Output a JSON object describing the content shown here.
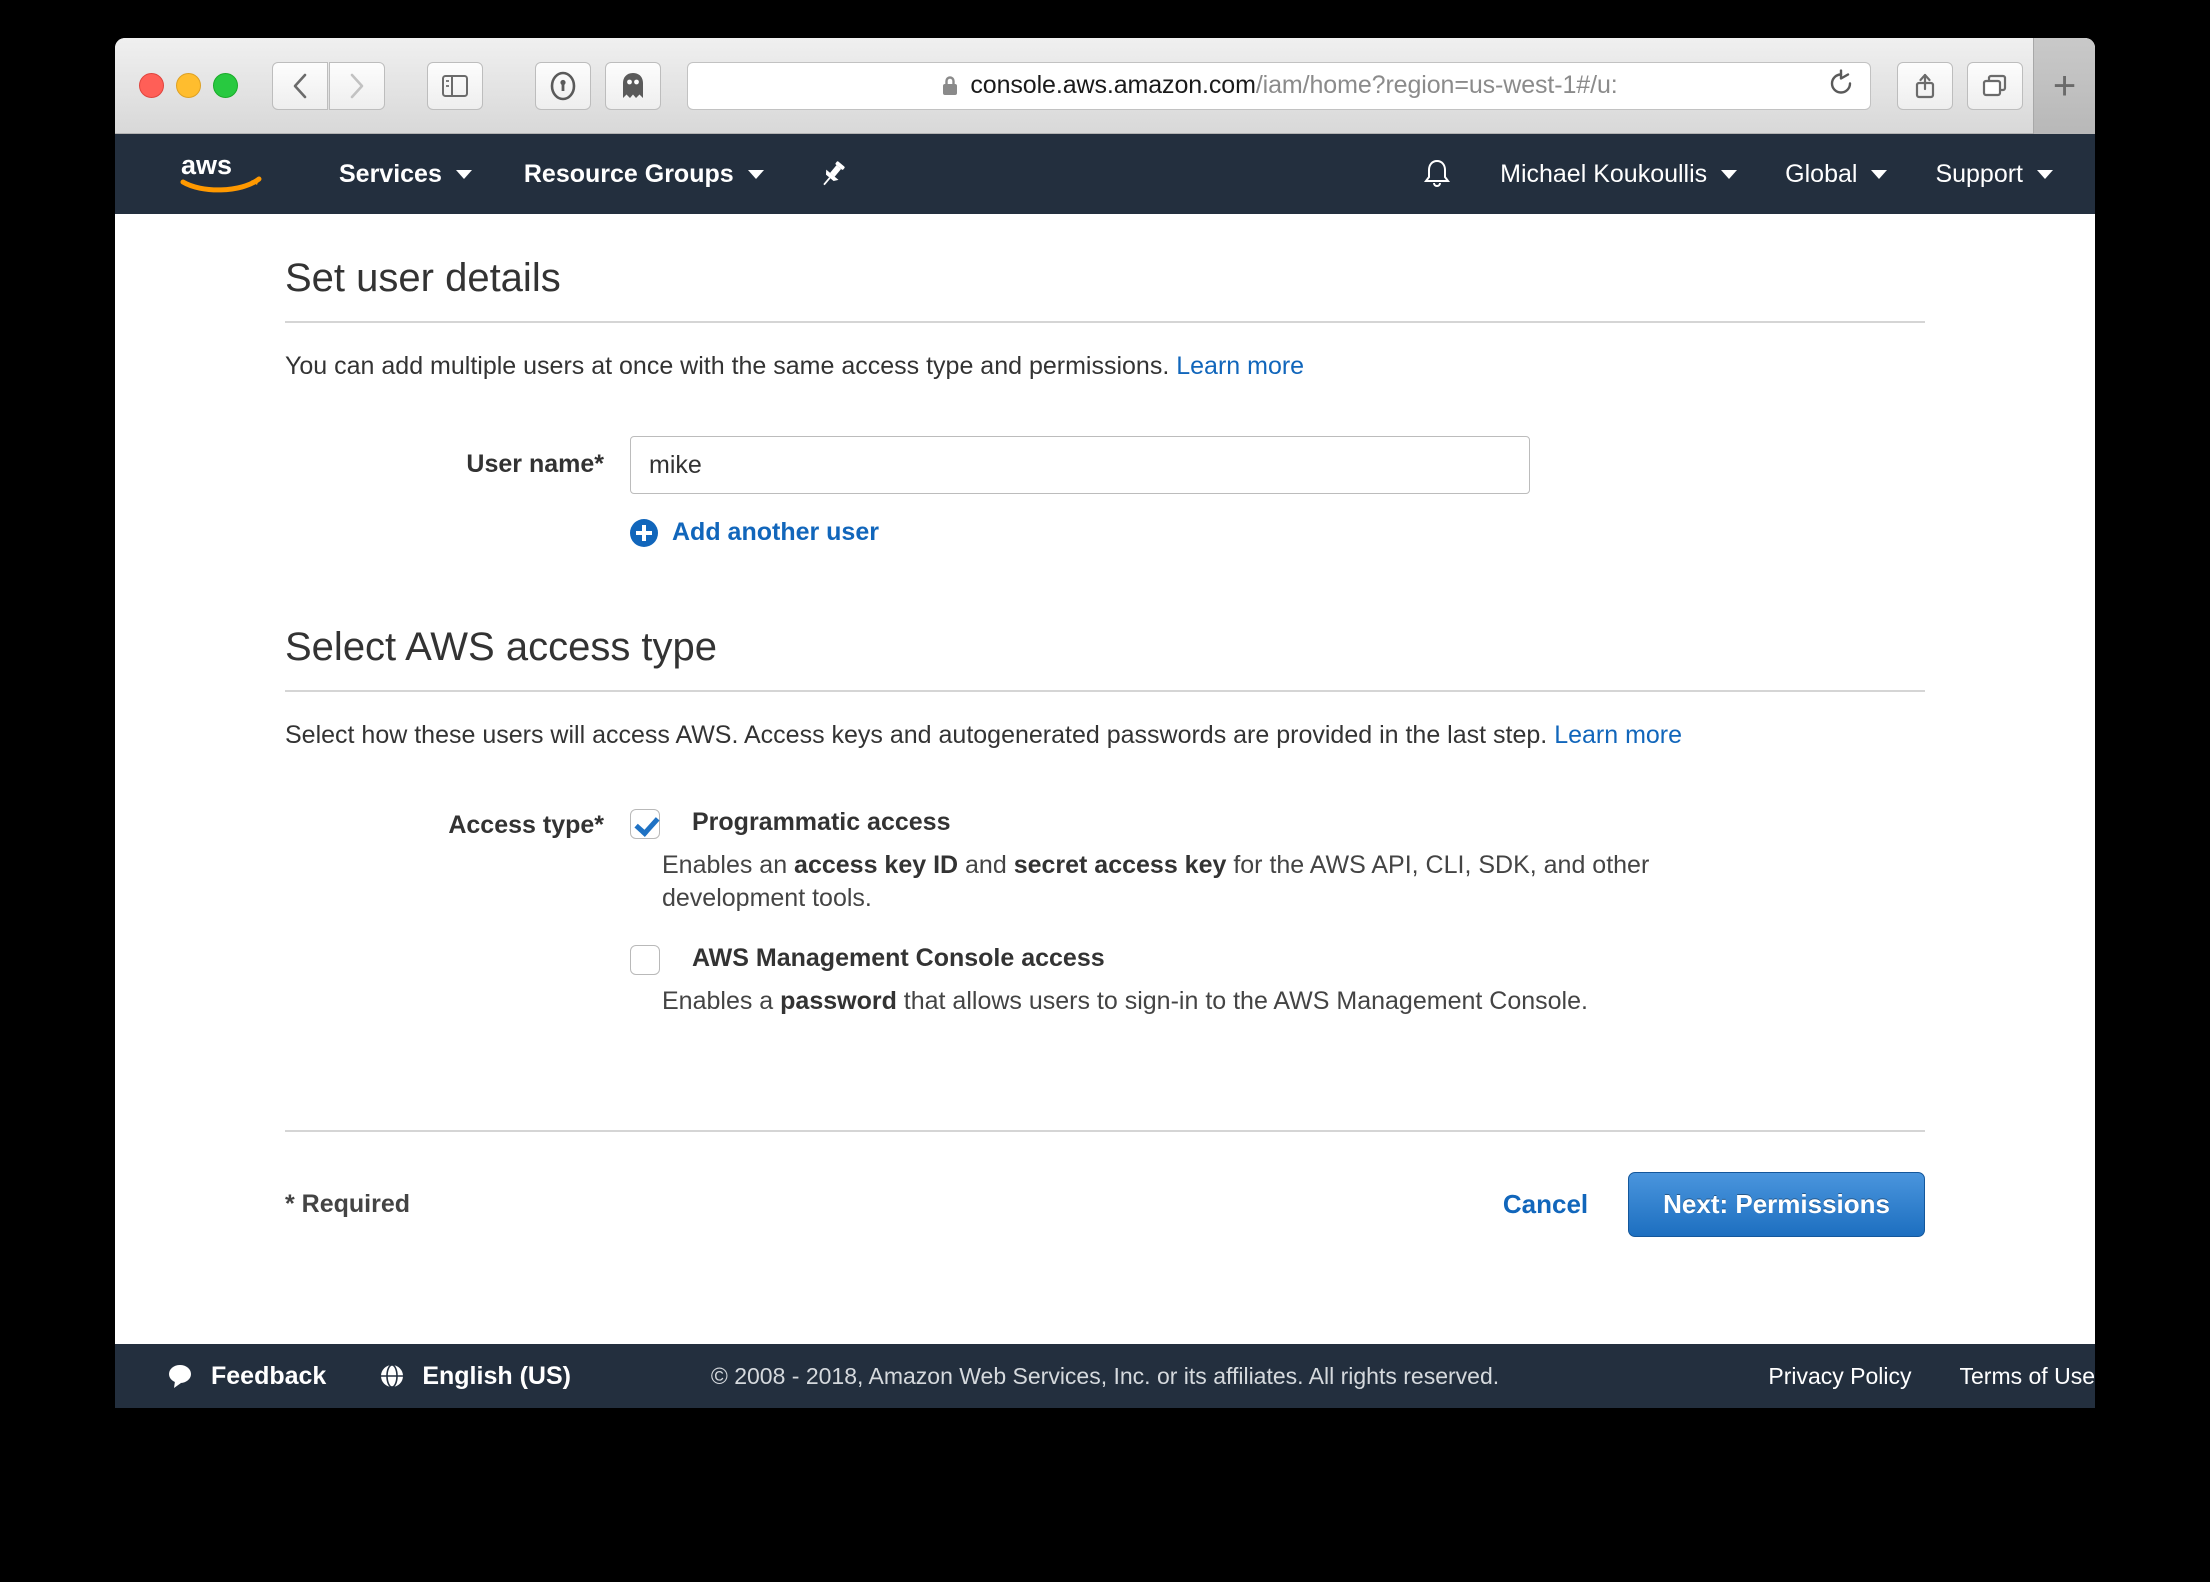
{
  "browser": {
    "url_domain": "console.aws.amazon.com",
    "url_path": "/iam/home?region=us-west-1#/u:",
    "lock_icon": "lock-icon",
    "back_icon": "chevron-left-icon",
    "forward_icon": "chevron-right-icon",
    "sidebar_icon": "sidebar-toggle-icon",
    "onepassword_icon": "1password-icon",
    "ghostery_icon": "ghostery-ghost-icon",
    "reload_icon": "reload-icon",
    "share_icon": "share-icon",
    "tabs_icon": "tab-overview-icon",
    "newtab_label": "+"
  },
  "navbar": {
    "logo": "aws-logo",
    "services": "Services",
    "resource_groups": "Resource Groups",
    "pin_icon": "pushpin-icon",
    "bell_icon": "bell-icon",
    "account": "Michael Koukoullis",
    "region": "Global",
    "support": "Support"
  },
  "main": {
    "title": "Set user details",
    "description": "You can add multiple users at once with the same access type and permissions.",
    "description_link": "Learn more",
    "user_name_label": "User name*",
    "user_name_value": "mike",
    "user_name_placeholder": "",
    "add_another_user": "Add another user",
    "section2_title": "Select AWS access type",
    "section2_description": "Select how these users will access AWS. Access keys and autogenerated passwords are provided in the last step.",
    "section2_link": "Learn more",
    "access_type_label": "Access type*",
    "options": [
      {
        "title": "Programmatic access",
        "checked": true,
        "desc_1": "Enables an ",
        "desc_b1": "access key ID",
        "desc_2": " and ",
        "desc_b2": "secret access key",
        "desc_3": " for the AWS API, CLI, SDK, and other development tools."
      },
      {
        "title": "AWS Management Console access",
        "checked": false,
        "desc_1": "Enables a ",
        "desc_b1": "password",
        "desc_2": " that allows users to sign-in to the AWS Management Console.",
        "desc_b2": "",
        "desc_3": ""
      }
    ],
    "required_note": "* Required",
    "cancel_label": "Cancel",
    "next_label": "Next: Permissions"
  },
  "footer": {
    "feedback_icon": "speech-bubble-icon",
    "feedback": "Feedback",
    "globe_icon": "globe-icon",
    "language": "English (US)",
    "copyright": "© 2008 - 2018, Amazon Web Services, Inc. or its affiliates. All rights reserved.",
    "privacy_policy": "Privacy Policy",
    "terms_of_use": "Terms of Use"
  },
  "colors": {
    "nav_background": "#232f3e",
    "link_blue": "#1166bb",
    "button_blue": "#1d6fc0",
    "aws_orange": "#ff9900",
    "checkbox_blue": "#1f72c4"
  }
}
